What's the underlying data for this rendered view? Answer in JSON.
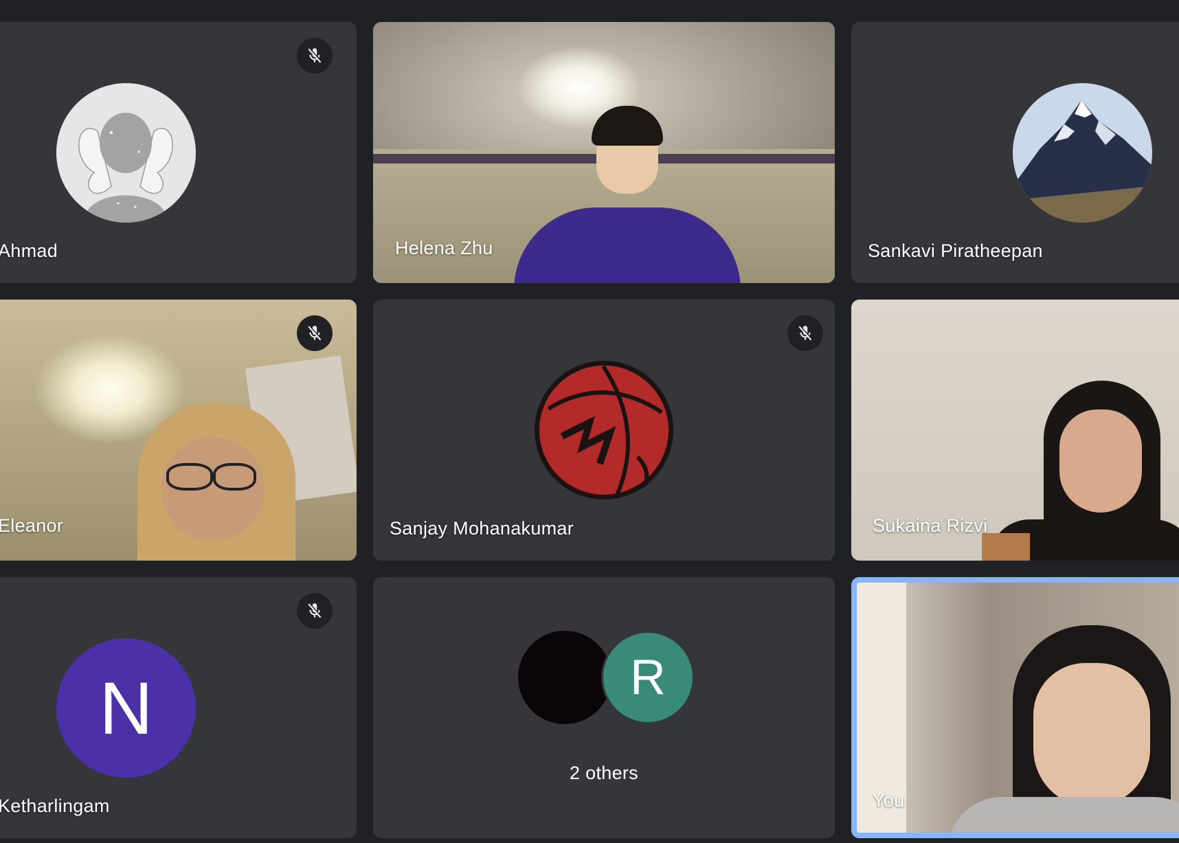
{
  "participants": [
    {
      "name": "Ahmad",
      "muted": true,
      "kind": "avatar-image",
      "icon": "fairy-avatar-icon"
    },
    {
      "name": "Helena Zhu",
      "muted": false,
      "kind": "video"
    },
    {
      "name": "Sankavi Piratheepan",
      "muted": false,
      "kind": "avatar-image",
      "icon": "mountain-avatar-icon"
    },
    {
      "name": "Eleanor",
      "muted": true,
      "kind": "video"
    },
    {
      "name": "Sanjay Mohanakumar",
      "muted": true,
      "kind": "avatar-image",
      "icon": "basketball-avatar-icon"
    },
    {
      "name": "Sukaina Rizvi",
      "muted": false,
      "kind": "video"
    },
    {
      "name": "Ketharlingam",
      "muted": true,
      "kind": "avatar-letter",
      "letter": "N",
      "color": "#4b30a8"
    },
    {
      "name": "2 others",
      "muted": false,
      "kind": "group",
      "letters": [
        "",
        "R"
      ],
      "colors": [
        "#0a0608",
        "#3a8a7a"
      ]
    },
    {
      "name": "You",
      "muted": false,
      "kind": "video",
      "self": true
    }
  ],
  "colors": {
    "background": "#202124",
    "tile": "#3c4043",
    "self_outline": "#8ab4f8",
    "mute_bg": "#202124"
  }
}
